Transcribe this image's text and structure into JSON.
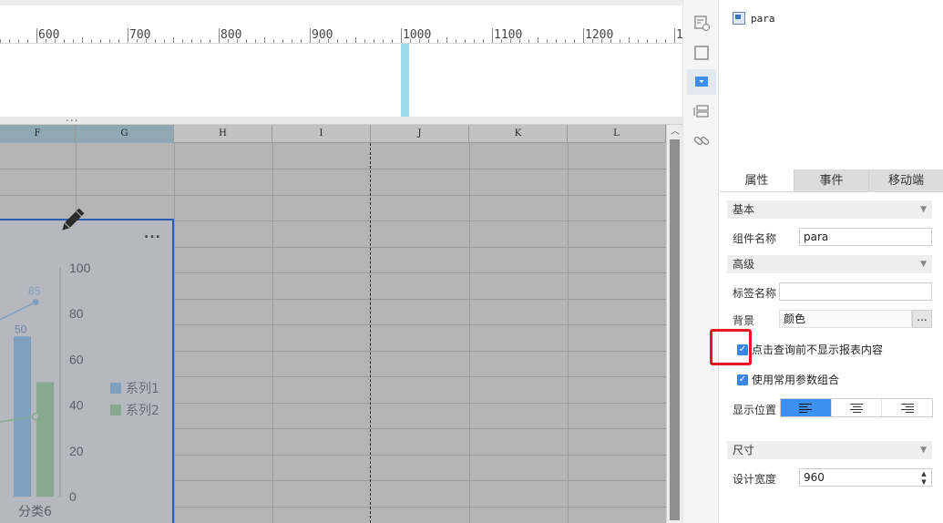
{
  "ruler": {
    "labels": [
      "600",
      "700",
      "800",
      "900",
      "1000",
      "1100",
      "1200",
      "1"
    ]
  },
  "splitter": {
    "grip": "..."
  },
  "sheet": {
    "columns": [
      "F",
      "G",
      "H",
      "I",
      "J",
      "K",
      "L"
    ],
    "selected_columns": [
      "F",
      "G"
    ]
  },
  "chart": {
    "more_label": "...",
    "legend": [
      {
        "name": "系列1",
        "color": "#7f9fbf"
      },
      {
        "name": "系列2",
        "color": "#86a98f"
      }
    ],
    "y_ticks": [
      "100",
      "80",
      "60",
      "40",
      "20",
      "0"
    ],
    "x_category": "分类6"
  },
  "chart_data": {
    "type": "bar",
    "categories": [
      "分类6"
    ],
    "series": [
      {
        "name": "系列1",
        "values": [
          70
        ],
        "line_value": 85
      },
      {
        "name": "系列2",
        "values": [
          50
        ],
        "line_value": 35
      }
    ],
    "data_labels": [
      "50",
      "85",
      "35"
    ],
    "ylim": [
      0,
      100
    ],
    "y_ticks": [
      0,
      20,
      40,
      60,
      80,
      100
    ],
    "legend_position": "right"
  },
  "icon_strip": {
    "icons": [
      "widget-settings-icon",
      "frame-icon",
      "dropdown-widget-icon",
      "layer-icon",
      "link-icon"
    ],
    "active": "dropdown-widget-icon"
  },
  "tree": {
    "item_label": "para"
  },
  "tabs": {
    "items": [
      "属性",
      "事件",
      "移动端"
    ],
    "active": "属性"
  },
  "props": {
    "basic_section": "基本",
    "widget_name_label": "组件名称",
    "widget_name_value": "para",
    "advanced_section": "高级",
    "tag_name_label": "标签名称",
    "tag_name_value": "",
    "background_label": "背景",
    "background_value": "颜色",
    "background_more": "...",
    "hide_before_query_label": "点击查询前不显示报表内容",
    "hide_before_query_checked": true,
    "use_param_combo_label": "使用常用参数组合",
    "use_param_combo_checked": true,
    "display_position_label": "显示位置",
    "display_position_options": [
      "left",
      "center",
      "right"
    ],
    "display_position_selected": "left",
    "size_section": "尺寸",
    "design_width_label": "设计宽度",
    "design_width_value": "960"
  },
  "colors": {
    "accent": "#3d8ff0",
    "highlight": "#e8191e",
    "chart_border": "#2a5db0",
    "guide_marker": "#9bdcea"
  }
}
